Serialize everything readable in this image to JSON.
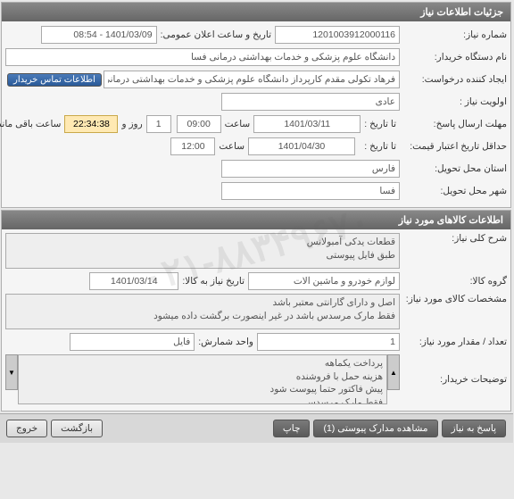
{
  "panel1": {
    "title": "جزئیات اطلاعات نیاز",
    "need_no_label": "شماره نیاز:",
    "need_no": "1201003912000116",
    "ann_label": "تاریخ و ساعت اعلان عمومی:",
    "ann_value": "1401/03/09 - 08:54",
    "org_label": "نام دستگاه خریدار:",
    "org_value": "دانشگاه علوم پزشکی و خدمات بهداشتی درمانی فسا",
    "creator_label": "ایجاد کننده درخواست:",
    "creator_value": "فرهاد تکولی مقدم کارپرداز دانشگاه علوم پزشکی و خدمات بهداشتی درمانی فسا",
    "contact_btn": "اطلاعات تماس خریدار",
    "priority_label": "اولویت نیاز :",
    "priority_value": "عادی",
    "reply_deadline_label": "مهلت ارسال پاسخ:",
    "to_date_label": "تا تاریخ :",
    "reply_date": "1401/03/11",
    "time_label": "ساعت",
    "reply_time": "09:00",
    "remain_days": "1",
    "days_and": "روز و",
    "remain_time": "22:34:38",
    "remain_label": "ساعت باقی مانده",
    "price_valid_label": "حداقل تاریخ اعتبار قیمت:",
    "price_valid_date": "1401/04/30",
    "price_valid_time": "12:00",
    "province_label": "استان محل تحویل:",
    "province_value": "فارس",
    "city_label": "شهر محل تحویل:",
    "city_value": "فسا"
  },
  "panel2": {
    "title": "اطلاعات کالاهای مورد نیاز",
    "desc_label": "شرح کلی نیاز:",
    "desc_value": "قطعات یدکی آمبولانس\nطبق فایل پیوستی",
    "group_label": "گروه کالا:",
    "group_value": "لوازم خودرو و ماشین آلات",
    "need_date_label": "تاریخ نیاز به کالا:",
    "need_date": "1401/03/14",
    "spec_label": "مشخصات کالای مورد نیاز:",
    "spec_value": "اصل و دارای گارانتی معتبر باشد\nفقط مارک مرسدس باشد در غیر اینصورت برگشت داده میشود",
    "qty_label": "تعداد / مقدار مورد نیاز:",
    "qty_value": "1",
    "unit_label": "واحد شمارش:",
    "unit_value": "فایل",
    "buyer_notes_label": "توضیحات خریدار:",
    "buyer_notes_value": "پرداخت یکماهه\nهزینه حمل با فروشنده\nپیش فاکتور حتما پیوست شود\nفقط مارک مرسدس"
  },
  "footer": {
    "reply_btn": "پاسخ به نیاز",
    "attach_btn": "مشاهده مدارک پیوستی (1)",
    "print_btn": "چاپ",
    "back_btn": "بازگشت",
    "exit_btn": "خروج"
  },
  "watermark": "۰۲۱-۸۸۳۴۹۶۷۰"
}
